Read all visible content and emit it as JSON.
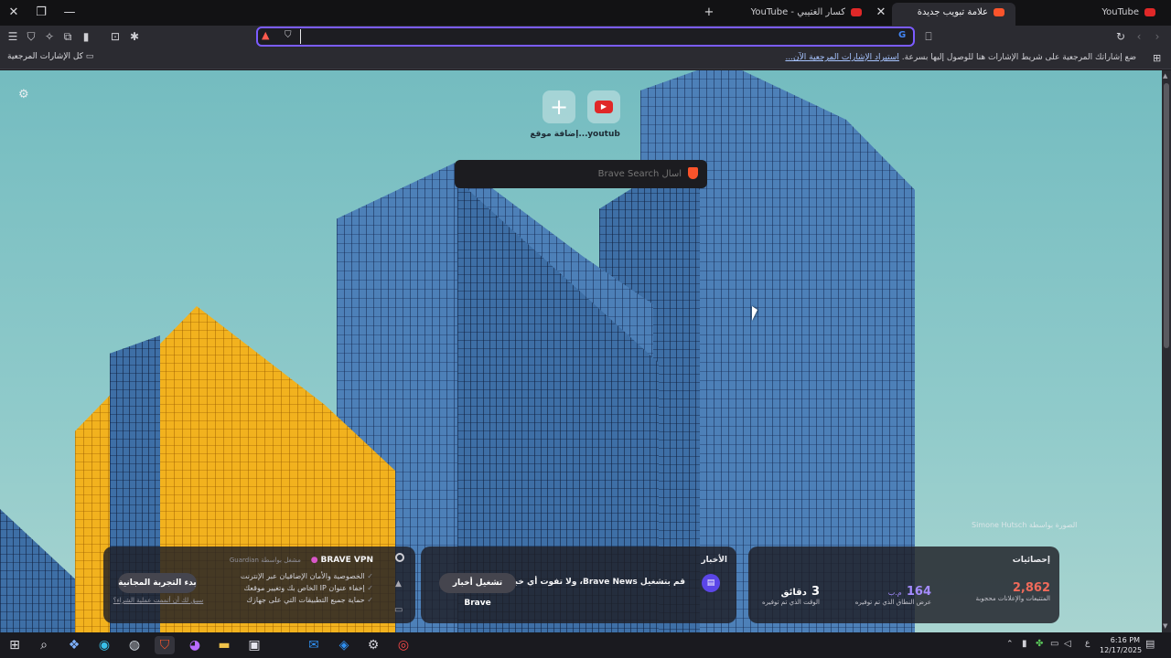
{
  "tabs": [
    {
      "title": "YouTube",
      "favicon_color": "#e02828"
    },
    {
      "title": "علامة تبويب جديدة",
      "favicon_color": "#fb542b",
      "active": true
    },
    {
      "title": "كسار الغتيبي - YouTube",
      "favicon_color": "#e02828"
    }
  ],
  "address_bar": {
    "value": ""
  },
  "bookmarks_bar": {
    "hint": "ضع إشاراتك المرجعية على شريط الإشارات هنا للوصول إليها بسرعة.",
    "import_link": "استيراد الإشارات المرجعية الآن...",
    "all_bookmarks": "كل الإشارات المرجعية"
  },
  "top_sites": [
    {
      "label": "youtub",
      "icon": "youtube-icon"
    },
    {
      "label": "إضافة موقع...",
      "icon": "plus-icon"
    }
  ],
  "search": {
    "placeholder": "اسأل Brave Search"
  },
  "photo_credit": "الصورة بواسطة Simone Hutsch",
  "vpn": {
    "title": "BRAVE VPN",
    "provider": "مشغل بواسطة Guardian",
    "features": [
      "الخصوصية والأمان الإضافيان عبر الإنترنت",
      "إخفاء عنوان IP الخاص بك وتغيير موقعك",
      "حماية جميع التطبيقات التي على جهازك"
    ],
    "cta": "بدء التجربة المجانية",
    "restore_link": "سبق لك أن أتممت عملية الشراء؟"
  },
  "news": {
    "title": "الأخبار",
    "message": "قم بتشغيل Brave News، ولا تفوت أي خبر",
    "cta": "تشغيل أخبار Brave"
  },
  "stats": {
    "title": "إحصائيات",
    "items": [
      {
        "value": "2,862",
        "label": "المتتبعات والإعلانات محجوبة",
        "color": "#f16a5a"
      },
      {
        "value": "164",
        "unit": "م.ب",
        "label": "عرض النطاق الذي تم توفيره",
        "color": "#a48cff"
      },
      {
        "value": "3",
        "unit": "دقائق",
        "label": "الوقت الذي تم توفيره",
        "color": "#ffffff"
      }
    ]
  },
  "taskbar": {
    "lang": "ع",
    "time": "6:16 PM",
    "date": "12/17/2025"
  }
}
